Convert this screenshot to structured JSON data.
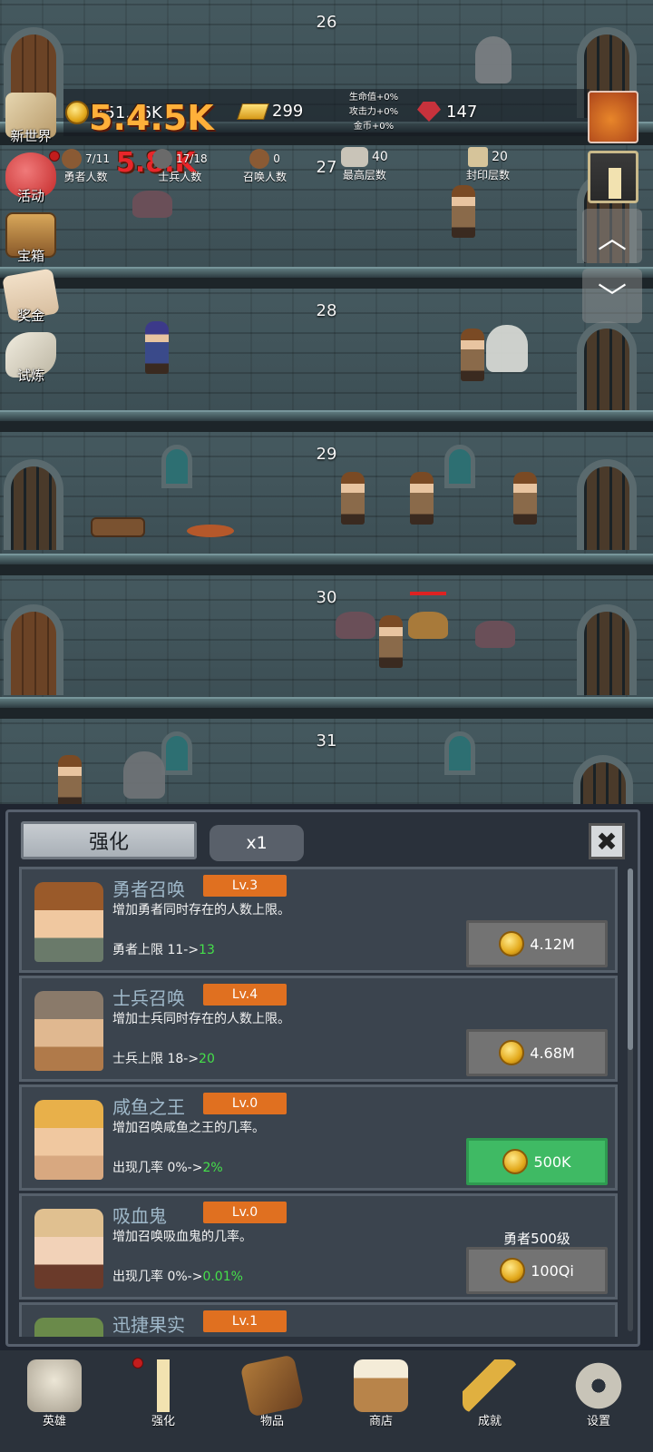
{
  "floors": [
    "26",
    "27",
    "28",
    "29",
    "30",
    "31"
  ],
  "hud": {
    "coins": "751.46K",
    "gold_bars": "299",
    "gems": "147",
    "bonus": [
      "生命值+0%",
      "攻击力+0%",
      "金币+0%"
    ],
    "damage_popups": [
      "5.4.5K",
      "5.8.K"
    ]
  },
  "stats": [
    {
      "value": "7/11",
      "label": "勇者人数"
    },
    {
      "value": "17/18",
      "label": "士兵人数"
    },
    {
      "value": "0",
      "label": "召唤人数"
    },
    {
      "value": "40",
      "label": "最高层数"
    },
    {
      "value": "20",
      "label": "封印层数"
    }
  ],
  "side_menu": [
    {
      "label": "新世界",
      "icon": "map-icon"
    },
    {
      "label": "活动",
      "icon": "heart-icon"
    },
    {
      "label": "宝箱",
      "icon": "chest-icon"
    },
    {
      "label": "奖金",
      "icon": "envelope-icon"
    },
    {
      "label": "试炼",
      "icon": "feather-icon"
    }
  ],
  "panel": {
    "tab_label": "强化",
    "multiplier": "x1",
    "close": "✖",
    "cards": [
      {
        "title": "勇者召唤",
        "level": "Lv.3",
        "desc": "增加勇者同时存在的人数上限。",
        "line_prefix": "勇者上限 11->",
        "line_next": "13",
        "cost": "4.12M",
        "style": "gray",
        "requirement": ""
      },
      {
        "title": "士兵召唤",
        "level": "Lv.4",
        "desc": "增加士兵同时存在的人数上限。",
        "line_prefix": "士兵上限 18->",
        "line_next": "20",
        "cost": "4.68M",
        "style": "gray",
        "requirement": ""
      },
      {
        "title": "咸鱼之王",
        "level": "Lv.0",
        "desc": "增加召唤咸鱼之王的几率。",
        "line_prefix": "出现几率 0%->",
        "line_next": "2%",
        "cost": "500K",
        "style": "green",
        "requirement": ""
      },
      {
        "title": "吸血鬼",
        "level": "Lv.0",
        "desc": "增加召唤吸血鬼的几率。",
        "line_prefix": "出现几率 0%->",
        "line_next": "0.01%",
        "cost": "100Qi",
        "style": "gray",
        "requirement": "勇者500级"
      },
      {
        "title": "迅捷果实",
        "level": "Lv.1",
        "desc": "",
        "line_prefix": "",
        "line_next": "",
        "cost": "",
        "style": "gray",
        "requirement": ""
      }
    ]
  },
  "nav": [
    {
      "label": "英雄",
      "icon": "skull-icon"
    },
    {
      "label": "强化",
      "icon": "candle-icon"
    },
    {
      "label": "物品",
      "icon": "book-icon"
    },
    {
      "label": "商店",
      "icon": "mug-icon"
    },
    {
      "label": "成就",
      "icon": "key-icon"
    },
    {
      "label": "设置",
      "icon": "gear-icon"
    }
  ],
  "colors": {
    "accent_orange": "#e07020",
    "buy_green": "#3fba64",
    "next_value_green": "#45e04a"
  }
}
